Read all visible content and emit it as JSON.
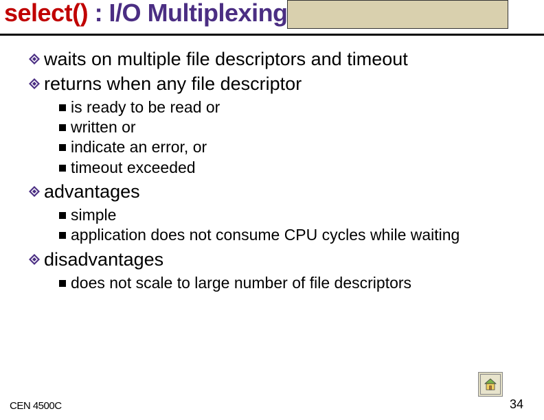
{
  "title": {
    "select_part": "select()",
    "rest_part": " : I/O Multiplexing"
  },
  "bullets": {
    "b1": "waits on multiple file descriptors and timeout",
    "b2": "returns when any file descriptor",
    "b2_sub": {
      "s1": "is ready to be read or",
      "s2": "written or",
      "s3": "indicate an error, or",
      "s4": "timeout exceeded"
    },
    "b3": "advantages",
    "b3_sub": {
      "s1": "simple",
      "s2": "application does not consume CPU cycles while waiting"
    },
    "b4": "disadvantages",
    "b4_sub": {
      "s1": "does not scale to large number of file descriptors"
    }
  },
  "footer": {
    "course": "CEN 4500C",
    "page": "34"
  }
}
